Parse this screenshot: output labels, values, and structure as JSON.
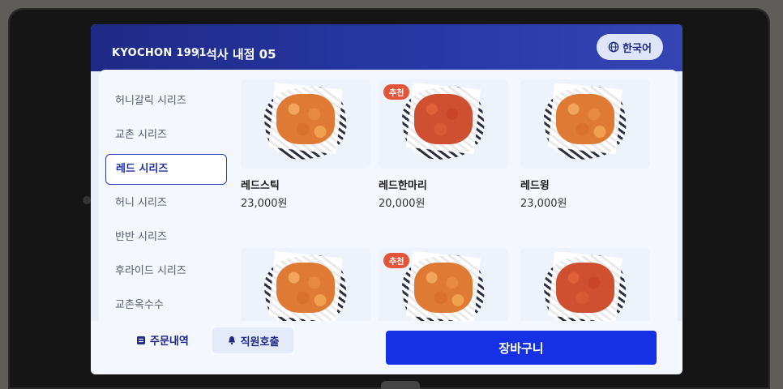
{
  "header": {
    "brand": "KYOCHON 1991",
    "store_name": "석사 내점 05",
    "language_label": "한국어"
  },
  "sidebar": {
    "items": [
      {
        "label": "허니갈릭 시리즈"
      },
      {
        "label": "교촌 시리즈"
      },
      {
        "label": "레드 시리즈"
      },
      {
        "label": "허니 시리즈"
      },
      {
        "label": "반반 시리즈"
      },
      {
        "label": "후라이드 시리즈"
      },
      {
        "label": "교촌옥수수"
      }
    ],
    "active_label": "레드 시리즈"
  },
  "products": [
    {
      "name": "레드스틱",
      "price": "23,000원",
      "badge": ""
    },
    {
      "name": "레드한마리",
      "price": "20,000원",
      "badge": "추천"
    },
    {
      "name": "레드윙",
      "price": "23,000원",
      "badge": ""
    },
    {
      "name": "",
      "price": "",
      "badge": ""
    },
    {
      "name": "",
      "price": "",
      "badge": "추천"
    },
    {
      "name": "",
      "price": "",
      "badge": ""
    }
  ],
  "footer": {
    "order_history_label": "주문내역",
    "staff_call_label": "직원호출",
    "cart_label": "장바구니"
  },
  "colors": {
    "header_bg": "#1f2a86",
    "active_category": "#2c3fb8",
    "cart_button": "#1630e3",
    "badge": "#e2553b"
  }
}
